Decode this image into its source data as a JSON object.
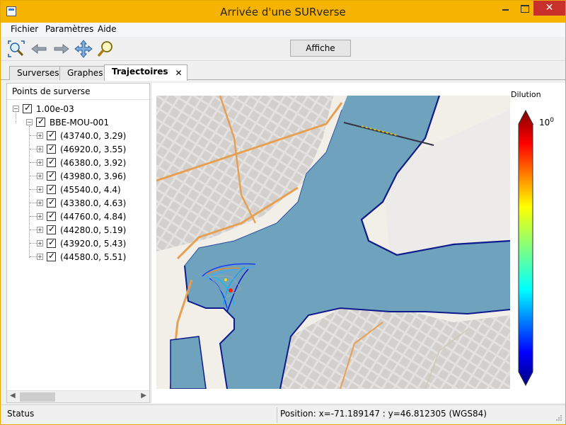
{
  "window": {
    "title": "Arrivée d'une SURverse",
    "close_glyph": "✕"
  },
  "menu": {
    "items": [
      "Fichier",
      "Paramètres",
      "Aide"
    ]
  },
  "toolbar": {
    "tools": [
      "zoom-extent-icon",
      "back-arrow-icon",
      "forward-arrow-icon",
      "pan-icon",
      "zoom-magnifier-icon"
    ],
    "affiche_label": "Affiche"
  },
  "tabs": [
    {
      "label": "Surverses",
      "active": false
    },
    {
      "label": "Graphes",
      "active": false
    },
    {
      "label": "Trajectoires",
      "active": true
    }
  ],
  "tab_close_glyph": "✕",
  "tree": {
    "header": "Points de surverse",
    "root": "1.00e-03",
    "station": "BBE-MOU-001",
    "points": [
      "(43740.0, 3.29)",
      "(46920.0, 3.55)",
      "(46380.0, 3.92)",
      "(43980.0, 3.96)",
      "(45540.0, 4.4)",
      "(43380.0, 4.63)",
      "(44760.0, 4.84)",
      "(44280.0, 5.19)",
      "(43920.0, 5.43)",
      "(44580.0, 5.51)"
    ]
  },
  "colorbar": {
    "label": "Dilution",
    "tick": "10",
    "tick_exponent": "0"
  },
  "status": {
    "left": "Status",
    "position": "Position: x=-71.189147 : y=46.812305 (WGS84)"
  },
  "colors": {
    "titlebar": "#f6b300",
    "water": "#6fa3bd",
    "shore": "#0d1b8c",
    "road": "#e7a052"
  }
}
